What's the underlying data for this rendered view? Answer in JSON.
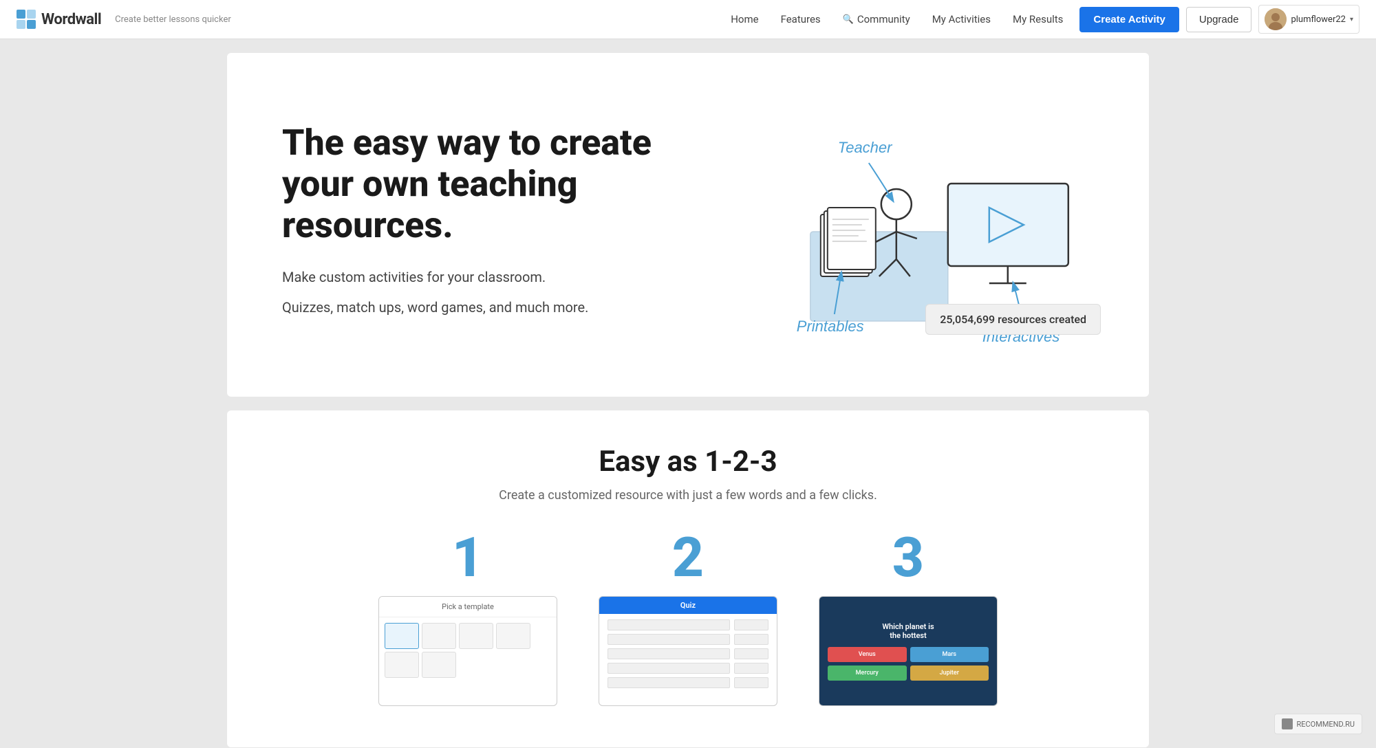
{
  "nav": {
    "logo_text": "Wordwall",
    "tagline": "Create better lessons quicker",
    "links": [
      {
        "label": "Home",
        "id": "home"
      },
      {
        "label": "Features",
        "id": "features"
      },
      {
        "label": "Community",
        "id": "community",
        "icon": "search"
      },
      {
        "label": "My Activities",
        "id": "my-activities"
      },
      {
        "label": "My Results",
        "id": "my-results"
      }
    ],
    "create_button": "Create Activity",
    "upgrade_button": "Upgrade",
    "user_name": "plumflower22"
  },
  "hero": {
    "title": "The easy way to create your own teaching resources.",
    "subtitle1": "Make custom activities for your classroom.",
    "subtitle2": "Quizzes, match ups, word games, and much more.",
    "stats_badge": "25,054,699 resources created",
    "illustration": {
      "teacher_label": "Teacher",
      "printables_label": "Printables",
      "interactives_label": "Interactives"
    }
  },
  "easy_section": {
    "title": "Easy as 1-2-3",
    "subtitle": "Create a customized resource with just a few words and a few clicks.",
    "steps": [
      {
        "number": "1",
        "card_header": "Pick a template"
      },
      {
        "number": "2",
        "card_header": "Quiz"
      },
      {
        "number": "3",
        "card_header": "Which planet is",
        "subtext": "the hottest"
      }
    ]
  },
  "recommend": {
    "label": "RECOMMEND.RU"
  }
}
